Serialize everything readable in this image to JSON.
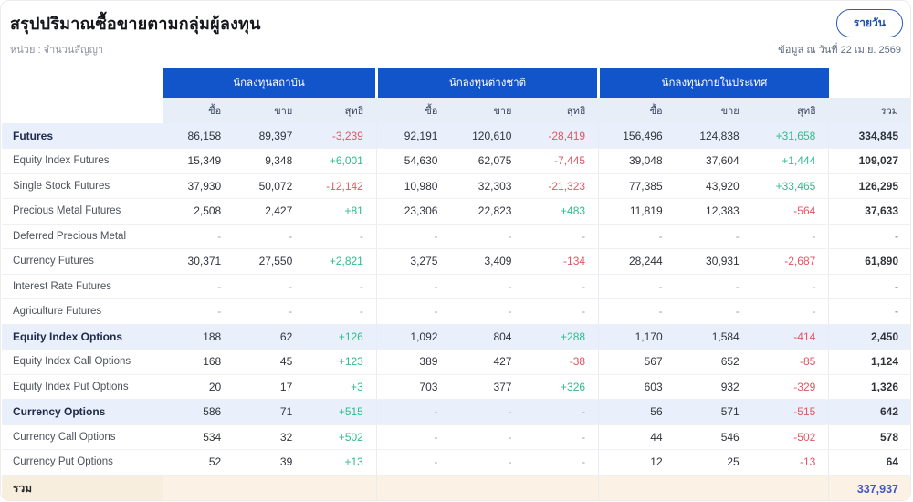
{
  "header": {
    "title": "สรุปปริมาณซื้อขายตามกลุ่มผู้ลงทุน",
    "unit_label": "หน่วย : จำนวนสัญญา",
    "period_button": "รายวัน",
    "as_of": "ข้อมูล ณ วันที่ 22 เม.ย. 2569"
  },
  "colors": {
    "header_blue": "#1254c9",
    "subheader_bg": "#e8eef8",
    "category_row_bg": "#e9f0fb",
    "total_row_bg": "#fbf2e5",
    "positive": "#2dbd8b",
    "negative": "#e25663",
    "total_value_blue": "#4356c5"
  },
  "table": {
    "groups": [
      {
        "label": "นักลงทุนสถาบัน"
      },
      {
        "label": "นักลงทุนต่างชาติ"
      },
      {
        "label": "นักลงทุนภายในประเทศ"
      }
    ],
    "sub_columns": [
      "ซื้อ",
      "ขาย",
      "สุทธิ"
    ],
    "total_column": "รวม",
    "rows": [
      {
        "label": "Futures",
        "style": "category",
        "cells": [
          "86,158",
          "89,397",
          "-3,239",
          "92,191",
          "120,610",
          "-28,419",
          "156,496",
          "124,838",
          "+31,658",
          "334,845"
        ]
      },
      {
        "label": "Equity Index Futures",
        "style": "normal",
        "cells": [
          "15,349",
          "9,348",
          "+6,001",
          "54,630",
          "62,075",
          "-7,445",
          "39,048",
          "37,604",
          "+1,444",
          "109,027"
        ]
      },
      {
        "label": "Single Stock Futures",
        "style": "normal",
        "cells": [
          "37,930",
          "50,072",
          "-12,142",
          "10,980",
          "32,303",
          "-21,323",
          "77,385",
          "43,920",
          "+33,465",
          "126,295"
        ]
      },
      {
        "label": "Precious Metal Futures",
        "style": "normal",
        "cells": [
          "2,508",
          "2,427",
          "+81",
          "23,306",
          "22,823",
          "+483",
          "11,819",
          "12,383",
          "-564",
          "37,633"
        ]
      },
      {
        "label": "Deferred Precious Metal",
        "style": "normal",
        "cells": [
          "-",
          "-",
          "-",
          "-",
          "-",
          "-",
          "-",
          "-",
          "-",
          "-"
        ]
      },
      {
        "label": "Currency Futures",
        "style": "normal",
        "cells": [
          "30,371",
          "27,550",
          "+2,821",
          "3,275",
          "3,409",
          "-134",
          "28,244",
          "30,931",
          "-2,687",
          "61,890"
        ]
      },
      {
        "label": "Interest Rate Futures",
        "style": "normal",
        "cells": [
          "-",
          "-",
          "-",
          "-",
          "-",
          "-",
          "-",
          "-",
          "-",
          "-"
        ]
      },
      {
        "label": "Agriculture Futures",
        "style": "normal",
        "cells": [
          "-",
          "-",
          "-",
          "-",
          "-",
          "-",
          "-",
          "-",
          "-",
          "-"
        ]
      },
      {
        "label": "Equity Index Options",
        "style": "category",
        "cells": [
          "188",
          "62",
          "+126",
          "1,092",
          "804",
          "+288",
          "1,170",
          "1,584",
          "-414",
          "2,450"
        ]
      },
      {
        "label": "Equity Index Call Options",
        "style": "normal",
        "cells": [
          "168",
          "45",
          "+123",
          "389",
          "427",
          "-38",
          "567",
          "652",
          "-85",
          "1,124"
        ]
      },
      {
        "label": "Equity Index Put Options",
        "style": "normal",
        "cells": [
          "20",
          "17",
          "+3",
          "703",
          "377",
          "+326",
          "603",
          "932",
          "-329",
          "1,326"
        ]
      },
      {
        "label": "Currency Options",
        "style": "category",
        "cells": [
          "586",
          "71",
          "+515",
          "-",
          "-",
          "-",
          "56",
          "571",
          "-515",
          "642"
        ]
      },
      {
        "label": "Currency Call Options",
        "style": "normal",
        "cells": [
          "534",
          "32",
          "+502",
          "-",
          "-",
          "-",
          "44",
          "546",
          "-502",
          "578"
        ]
      },
      {
        "label": "Currency Put Options",
        "style": "normal",
        "cells": [
          "52",
          "39",
          "+13",
          "-",
          "-",
          "-",
          "12",
          "25",
          "-13",
          "64"
        ]
      },
      {
        "label": "รวม",
        "style": "total",
        "cells": [
          "",
          "",
          "",
          "",
          "",
          "",
          "",
          "",
          "",
          "337,937"
        ]
      }
    ]
  }
}
